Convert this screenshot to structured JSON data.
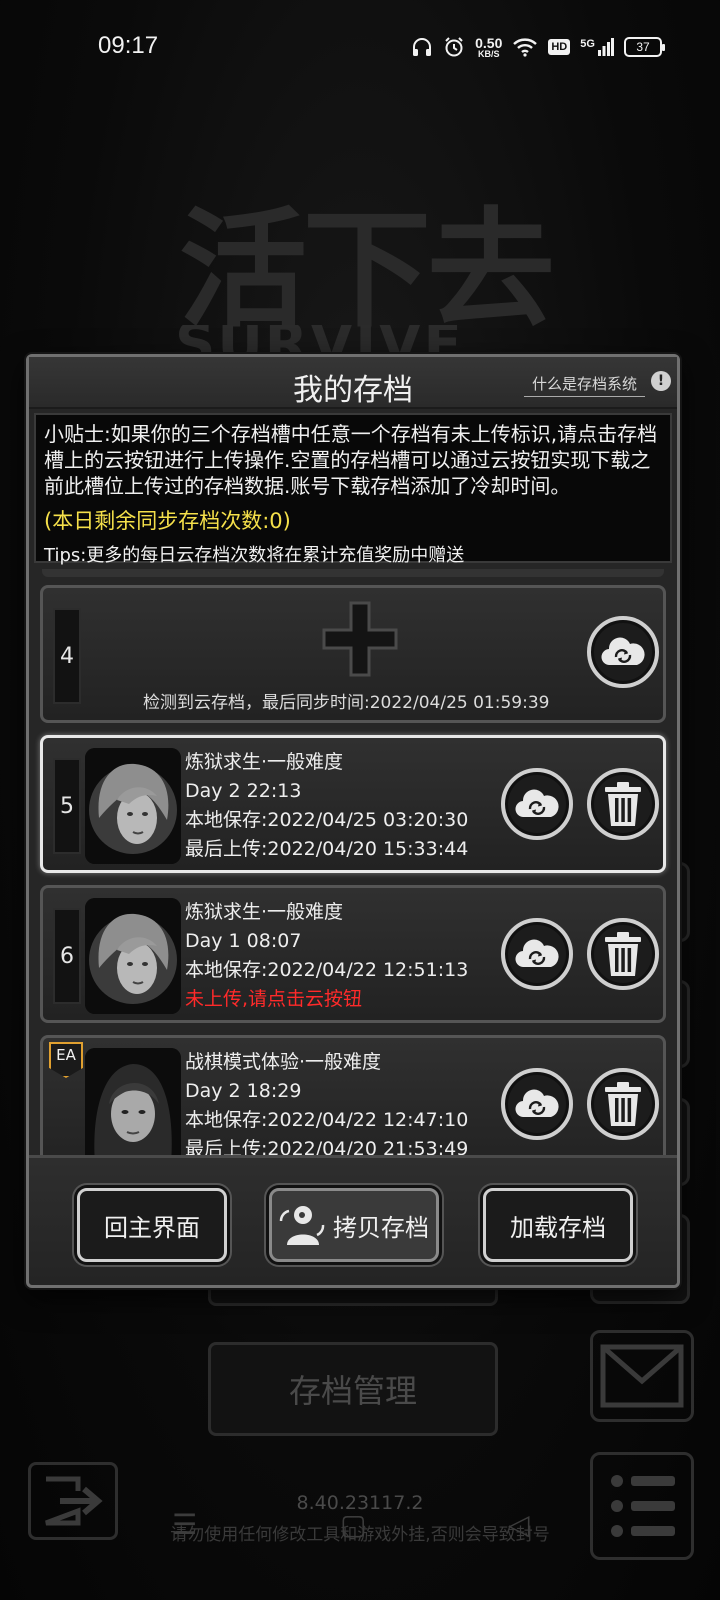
{
  "status": {
    "time": "09:17",
    "net_speed_value": "0.50",
    "net_speed_unit": "KB/S",
    "hd": "HD",
    "signal": "5G",
    "battery": "37"
  },
  "background": {
    "logo": "活下去",
    "logo_sub": "SURVIVE",
    "manage_label": "存档管理",
    "version": "8.40.23117.2",
    "warning": "请勿使用任何修改工具和游戏外挂,否则会导致封号"
  },
  "dialog": {
    "title": "我的存档",
    "help_label": "什么是存档系统",
    "help_icon": "!",
    "tips": {
      "text": "小贴士:如果你的三个存档槽中任意一个存档有未上传标识,请点击存档槽上的云按钮进行上传操作.空置的存档槽可以通过云按钮实现下载之前此槽位上传过的存档数据.账号下载存档添加了冷却时间。",
      "remaining": "(本日剩余同步存档次数:0)",
      "extra": "Tips:更多的每日云存档次数将在累计充值奖励中赠送"
    },
    "slots": [
      {
        "num": "4",
        "empty": true,
        "sync_text": "检测到云存档，最后同步时间:2022/04/25  01:59:39"
      },
      {
        "num": "5",
        "mode": "炼狱求生·一般难度",
        "day": "Day 2  22:13",
        "local_save": "本地保存:2022/04/25  03:20:30",
        "last_upload": "最后上传:2022/04/20  15:33:44",
        "selected": true
      },
      {
        "num": "6",
        "mode": "炼狱求生·一般难度",
        "day": "Day 1  08:07",
        "local_save": "本地保存:2022/04/22  12:51:13",
        "warning": "未上传,请点击云按钮"
      },
      {
        "badge": "EA",
        "mode": "战棋模式体验·一般难度",
        "day": "Day 2  18:29",
        "local_save": "本地保存:2022/04/22  12:47:10",
        "last_upload": "最后上传:2022/04/20  21:53:49"
      }
    ],
    "footer": {
      "home": "回主界面",
      "copy": "拷贝存档",
      "load": "加载存档"
    }
  },
  "icons": {
    "cloud": "cloud-sync-icon",
    "trash": "trash-icon",
    "plus": "plus-icon",
    "avatar": "survivor-portrait"
  }
}
